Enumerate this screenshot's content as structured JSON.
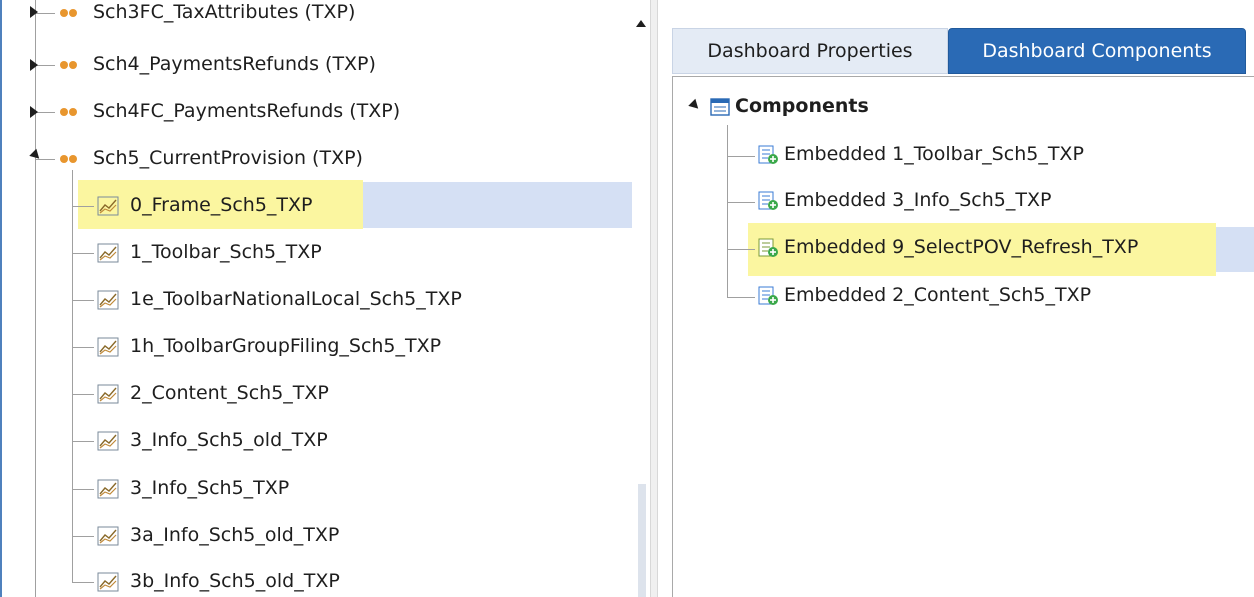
{
  "left_tree": {
    "items": [
      {
        "label": "Sch3FC_TaxAttributes (TXP)",
        "kind": "group",
        "state": "collapsed"
      },
      {
        "label": "Sch4_PaymentsRefunds (TXP)",
        "kind": "group",
        "state": "collapsed"
      },
      {
        "label": "Sch4FC_PaymentsRefunds (TXP)",
        "kind": "group",
        "state": "collapsed"
      },
      {
        "label": "Sch5_CurrentProvision (TXP)",
        "kind": "group",
        "state": "expanded"
      },
      {
        "label": "0_Frame_Sch5_TXP",
        "kind": "dashboard",
        "selected": true
      },
      {
        "label": "1_Toolbar_Sch5_TXP",
        "kind": "dashboard"
      },
      {
        "label": "1e_ToolbarNationalLocal_Sch5_TXP",
        "kind": "dashboard"
      },
      {
        "label": "1h_ToolbarGroupFiling_Sch5_TXP",
        "kind": "dashboard"
      },
      {
        "label": "2_Content_Sch5_TXP",
        "kind": "dashboard"
      },
      {
        "label": "3_Info_Sch5_old_TXP",
        "kind": "dashboard"
      },
      {
        "label": "3_Info_Sch5_TXP",
        "kind": "dashboard"
      },
      {
        "label": "3a_Info_Sch5_old_TXP",
        "kind": "dashboard"
      },
      {
        "label": "3b_Info_Sch5_old_TXP",
        "kind": "dashboard"
      }
    ]
  },
  "tabs": [
    {
      "label": "Dashboard Properties",
      "active": false
    },
    {
      "label": "Dashboard Components",
      "active": true
    }
  ],
  "components_tree": {
    "root_label": "Components",
    "items": [
      {
        "label": "Embedded 1_Toolbar_Sch5_TXP"
      },
      {
        "label": "Embedded 3_Info_Sch5_TXP"
      },
      {
        "label": "Embedded 9_SelectPOV_Refresh_TXP",
        "selected": true
      },
      {
        "label": "Embedded 2_Content_Sch5_TXP"
      }
    ]
  },
  "colors": {
    "highlight": "#fbf6a0",
    "selection": "#d5e0f4",
    "active_tab": "#2a6ab5",
    "group_dots": "#e8962e"
  }
}
